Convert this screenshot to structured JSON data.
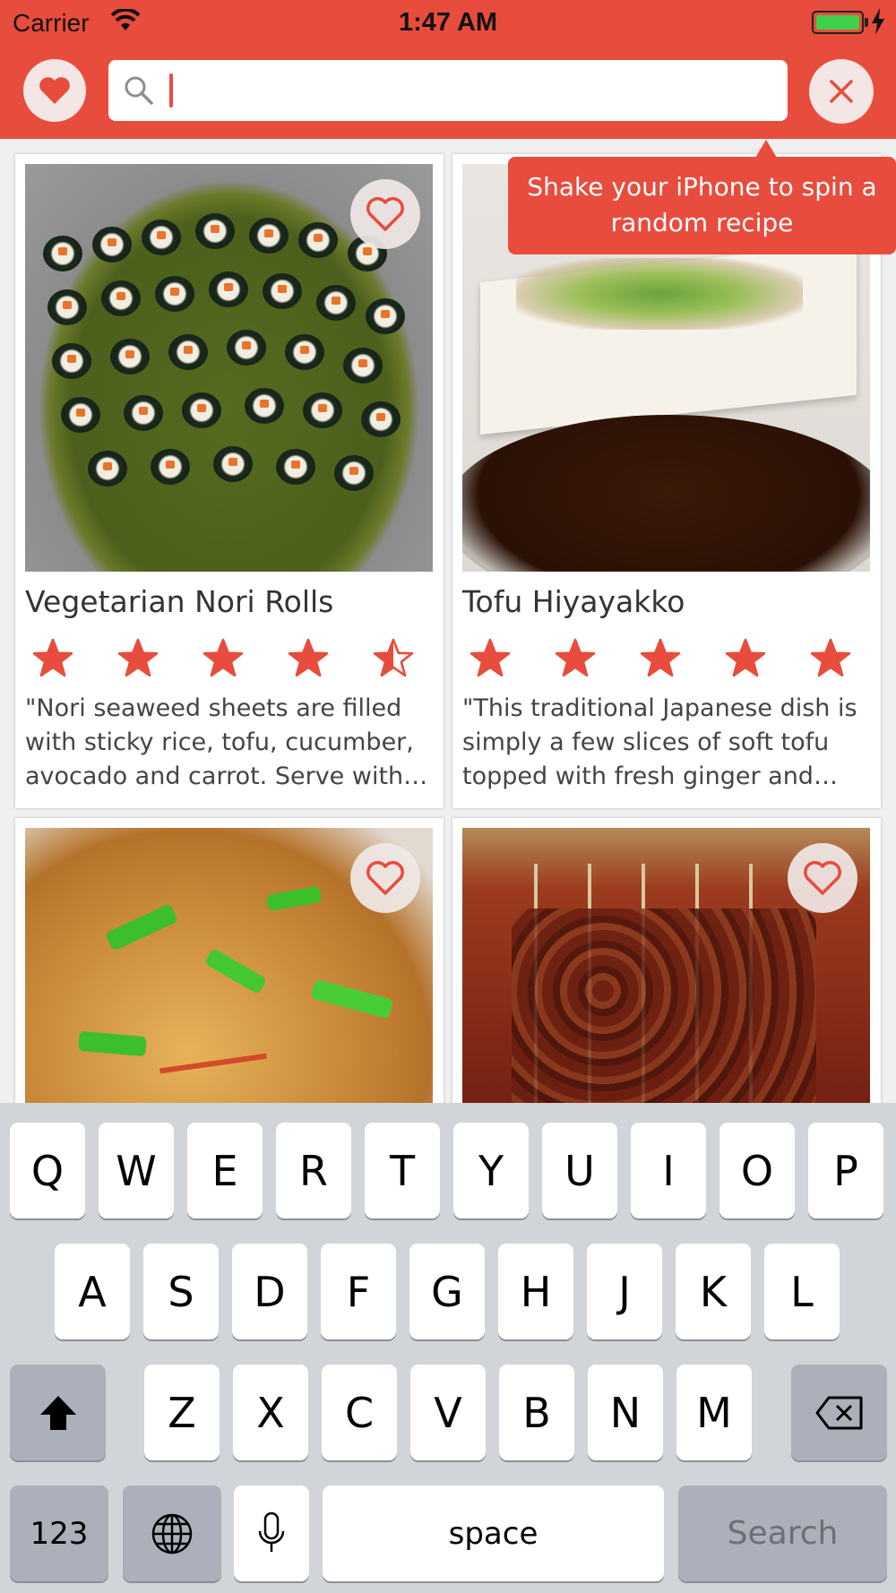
{
  "status_bar": {
    "carrier": "Carrier",
    "time": "1:47 AM",
    "battery_level": 1.0
  },
  "header": {
    "background_color": "#e84c3d",
    "favorites_icon": "heart-icon",
    "search": {
      "value": "",
      "placeholder": "",
      "icon": "search-icon"
    },
    "clear_icon": "close-icon"
  },
  "tooltip": {
    "text": "Shake your iPhone to spin a random recipe"
  },
  "recipes": [
    {
      "title": "Vegetarian Nori Rolls",
      "rating": 4.5,
      "description": "\"Nori seaweed sheets are filled with sticky rice, tofu, cucumber, avocado and carrot.  Serve with soy sauce.\"",
      "favorite_icon": "heart-outline-icon"
    },
    {
      "title": "Tofu Hiyayakko",
      "rating": 5,
      "description": "\"This traditional Japanese dish is simply a few slices of soft tofu topped with fresh ginger and green onions.\"",
      "favorite_icon": "heart-outline-icon"
    },
    {
      "title": "",
      "rating": null,
      "description": "",
      "favorite_icon": "heart-outline-icon"
    },
    {
      "title": "",
      "rating": null,
      "description": "",
      "favorite_icon": "heart-outline-icon"
    }
  ],
  "keyboard": {
    "row1": [
      "Q",
      "W",
      "E",
      "R",
      "T",
      "Y",
      "U",
      "I",
      "O",
      "P"
    ],
    "row2": [
      "A",
      "S",
      "D",
      "F",
      "G",
      "H",
      "J",
      "K",
      "L"
    ],
    "row3": [
      "Z",
      "X",
      "C",
      "V",
      "B",
      "N",
      "M"
    ],
    "numbers_key": "123",
    "space_key": "space",
    "search_key": "Search",
    "shift_icon": "shift-icon",
    "backspace_icon": "backspace-icon",
    "globe_icon": "globe-icon",
    "mic_icon": "microphone-icon"
  },
  "colors": {
    "accent": "#e84c3d",
    "star": "#e84c3d"
  }
}
